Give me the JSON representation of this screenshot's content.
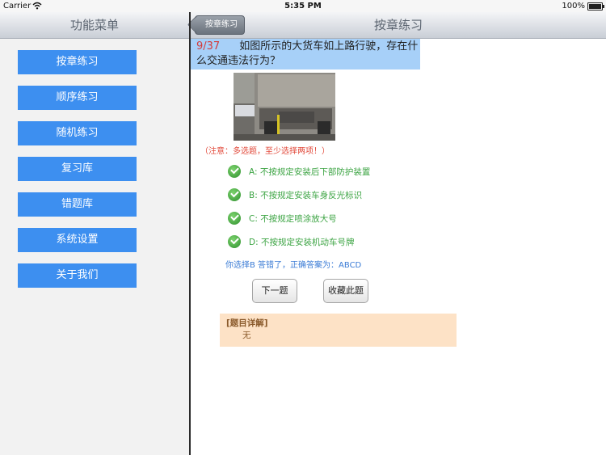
{
  "status_bar": {
    "carrier": "Carrier",
    "time": "5:35 PM",
    "battery": "100%"
  },
  "sidebar": {
    "title": "功能菜单",
    "items": [
      {
        "label": "按章练习"
      },
      {
        "label": "顺序练习"
      },
      {
        "label": "随机练习"
      },
      {
        "label": "复习库"
      },
      {
        "label": "错题库"
      },
      {
        "label": "系统设置"
      },
      {
        "label": "关于我们"
      }
    ]
  },
  "main": {
    "back_label": "按章练习",
    "title": "按章练习",
    "question": {
      "index": "9/37",
      "text": "如图所示的大货车如上路行驶，存在什么交通违法行为？"
    },
    "note": "（注意：多选题，至少选择两项！）",
    "options": [
      {
        "label": "A: 不按规定安装后下部防护装置"
      },
      {
        "label": "B: 不按规定安装车身反光标识"
      },
      {
        "label": "C: 不按规定喷涂放大号"
      },
      {
        "label": "D: 不按规定安装机动车号牌"
      }
    ],
    "answer_text": "你选择B  答错了，正确答案为：ABCD",
    "next_button": "下一题",
    "favorite_button": "收藏此题",
    "explanation": {
      "title": "[题目详解]",
      "body": "无"
    }
  },
  "colors": {
    "menu_button": "#3d8ff0",
    "option_text": "#3ca443",
    "note": "#e24a3b",
    "question_bg": "#a7d0f8",
    "explain_bg": "#fde2c6"
  }
}
